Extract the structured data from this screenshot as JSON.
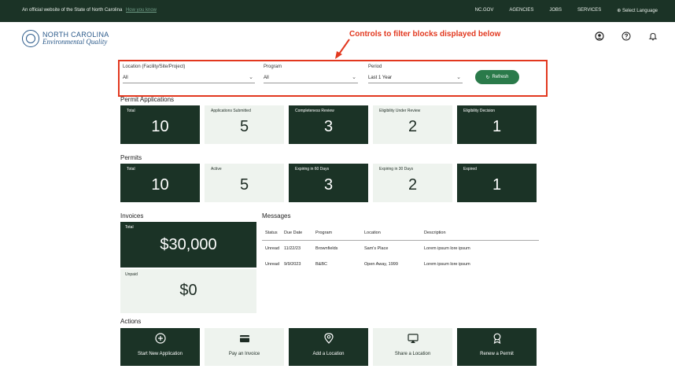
{
  "banner": {
    "official_text": "An official website of the State of North Carolina",
    "how_text": "How you know",
    "links": [
      "NC.GOV",
      "AGENCIES",
      "JOBS",
      "SERVICES"
    ],
    "language": "Select Language"
  },
  "header": {
    "logo_line1": "NORTH CAROLINA",
    "logo_line2": "Environmental Quality"
  },
  "annotation": {
    "text": "Controls to filter blocks displayed below",
    "color": "#e2381f"
  },
  "filters": {
    "location": {
      "label": "Location (Facility/Site/Project)",
      "value": "All"
    },
    "program": {
      "label": "Program",
      "value": "All"
    },
    "period": {
      "label": "Period",
      "value": "Last 1 Year"
    },
    "refresh_label": "Refresh"
  },
  "permit_applications": {
    "title": "Permit Applications",
    "cards": [
      {
        "label": "Total",
        "value": "10",
        "theme": "dark"
      },
      {
        "label": "Applications Submitted",
        "value": "5",
        "theme": "light"
      },
      {
        "label": "Completeness Review",
        "value": "3",
        "theme": "dark"
      },
      {
        "label": "Eligibility Under Review",
        "value": "2",
        "theme": "light"
      },
      {
        "label": "Eligibility Decision",
        "value": "1",
        "theme": "dark"
      }
    ]
  },
  "permits": {
    "title": "Permits",
    "cards": [
      {
        "label": "Total",
        "value": "10",
        "theme": "dark"
      },
      {
        "label": "Active",
        "value": "5",
        "theme": "light"
      },
      {
        "label": "Expiring in 60 Days",
        "value": "3",
        "theme": "dark"
      },
      {
        "label": "Expiring in 30 Days",
        "value": "2",
        "theme": "light"
      },
      {
        "label": "Expired",
        "value": "1",
        "theme": "dark"
      }
    ]
  },
  "invoices": {
    "title": "Invoices",
    "total_label": "Total",
    "total_value": "$30,000",
    "unpaid_label": "Unpaid",
    "unpaid_value": "$0"
  },
  "messages": {
    "title": "Messages",
    "columns": [
      "Status",
      "Due Date",
      "Program",
      "Location",
      "Description"
    ],
    "rows": [
      [
        "Unread",
        "11/22/23",
        "Brownfields",
        "Sam's Place",
        "Lorem ipsum lore ipsum"
      ],
      [
        "Unread",
        "9/9/2023",
        "B&BC",
        "Open Away, 1999",
        "Lorem ipsum lore ipsum"
      ]
    ]
  },
  "actions": {
    "title": "Actions",
    "items": [
      {
        "label": "Start New Application",
        "icon": "plus-circle-icon",
        "theme": "dark"
      },
      {
        "label": "Pay an Invoice",
        "icon": "credit-card-icon",
        "theme": "light"
      },
      {
        "label": "Add a Location",
        "icon": "map-pin-icon",
        "theme": "dark"
      },
      {
        "label": "Share a Location",
        "icon": "share-screen-icon",
        "theme": "light"
      },
      {
        "label": "Renew a Permit",
        "icon": "award-icon",
        "theme": "dark"
      }
    ]
  },
  "colors": {
    "dark_green": "#1b3326",
    "light_tile": "#eef3ee",
    "accent_green": "#2a7a4a"
  }
}
